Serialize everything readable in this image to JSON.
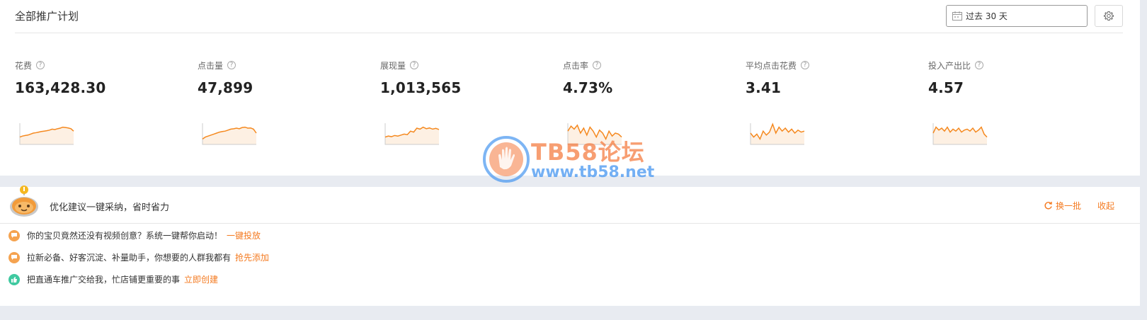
{
  "header": {
    "title": "全部推广计划",
    "date_range": "过去 30 天",
    "calendar_icon": "calendar-icon",
    "settings_icon": "gear-icon"
  },
  "metrics": [
    {
      "label": "花费",
      "value": "163,428.30"
    },
    {
      "label": "点击量",
      "value": "47,899"
    },
    {
      "label": "展现量",
      "value": "1,013,565"
    },
    {
      "label": "点击率",
      "value": "4.73%"
    },
    {
      "label": "平均点击花费",
      "value": "3.41"
    },
    {
      "label": "投入产出比",
      "value": "4.57"
    }
  ],
  "help_glyph": "?",
  "sparklines": [
    [
      0.3,
      0.35,
      0.38,
      0.4,
      0.45,
      0.5,
      0.52,
      0.55,
      0.58,
      0.6,
      0.62,
      0.65,
      0.7,
      0.68,
      0.72,
      0.75,
      0.8,
      0.78,
      0.76,
      0.72,
      0.6
    ],
    [
      0.2,
      0.3,
      0.35,
      0.4,
      0.45,
      0.5,
      0.55,
      0.58,
      0.6,
      0.65,
      0.7,
      0.72,
      0.75,
      0.72,
      0.78,
      0.8,
      0.75,
      0.76,
      0.7,
      0.5
    ],
    [
      0.3,
      0.35,
      0.32,
      0.38,
      0.35,
      0.4,
      0.45,
      0.42,
      0.6,
      0.55,
      0.75,
      0.7,
      0.8,
      0.72,
      0.76,
      0.7,
      0.74,
      0.68
    ],
    [
      0.6,
      0.85,
      0.7,
      0.9,
      0.5,
      0.75,
      0.4,
      0.8,
      0.6,
      0.3,
      0.65,
      0.5,
      0.2,
      0.6,
      0.35,
      0.5,
      0.45,
      0.3
    ],
    [
      0.5,
      0.3,
      0.45,
      0.2,
      0.6,
      0.4,
      0.55,
      0.95,
      0.5,
      0.8,
      0.6,
      0.75,
      0.55,
      0.7,
      0.5,
      0.65,
      0.55,
      0.6
    ],
    [
      0.5,
      0.8,
      0.65,
      0.75,
      0.6,
      0.8,
      0.55,
      0.7,
      0.6,
      0.75,
      0.55,
      0.65,
      0.7,
      0.6,
      0.75,
      0.55,
      0.65,
      0.8,
      0.45,
      0.3
    ]
  ],
  "watermark": {
    "title": "TB58论坛",
    "url": "www.tb58.net"
  },
  "suggestions_panel": {
    "title": "优化建议一键采纳，省时省力",
    "refresh_label": "换一批",
    "collapse_label": "收起",
    "items": [
      {
        "text": "你的宝贝竟然还没有视频创意？系统一键帮你启动！",
        "action": "一键投放",
        "icon": "chat-bubble-icon"
      },
      {
        "text": "拉新必备、好客沉淀、补量助手，你想要的人群我都有",
        "action": "抢先添加",
        "icon": "chat-bubble-icon"
      },
      {
        "text": "把直通车推广交给我，忙店铺更重要的事",
        "action": "立即创建",
        "icon": "thumbs-up-icon"
      }
    ]
  },
  "colors": {
    "accent": "#f47a20",
    "spark_line": "#f5891f",
    "spark_fill": "#fdf0e3",
    "thumb_icon": "#3fc9a0"
  }
}
